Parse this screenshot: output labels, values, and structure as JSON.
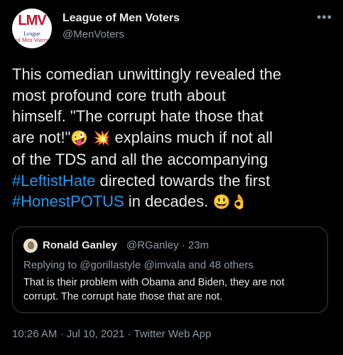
{
  "author": {
    "display_name": "League of Men Voters",
    "handle": "@MenVoters",
    "avatar_logo": "LMV",
    "avatar_line1": "League",
    "avatar_line2": "of Men Voters"
  },
  "more_icon": "more-horizontal-icon",
  "tweet": {
    "line1": "This comedian unwittingly revealed the",
    "line2": "most profound core truth about",
    "line3": "himself. \"The corrupt hate those that",
    "line4a": "are not!\"",
    "emoji_zany": "🤪",
    "emoji_collision": "💥",
    "line4b": " explains much if not all",
    "line5": "of the TDS and all the accompanying",
    "hashtag1": "#LeftistHate",
    "line6b": " directed towards the first",
    "hashtag2": "#HonestPOTUS",
    "line7b": " in decades. ",
    "emoji_smile": "😃",
    "emoji_ok": "👌"
  },
  "quoted_tweet": {
    "display_name": "Ronald Ganley",
    "handle_time": "@RGanley · 23m",
    "replying_to": "Replying to @gorillastyle @imvala and 48 others",
    "text": "That is their problem with Obama and Biden, they are not corrupt. The corrupt hate those that are not."
  },
  "meta": "10:26 AM · Jul 10, 2021 · Twitter Web App"
}
